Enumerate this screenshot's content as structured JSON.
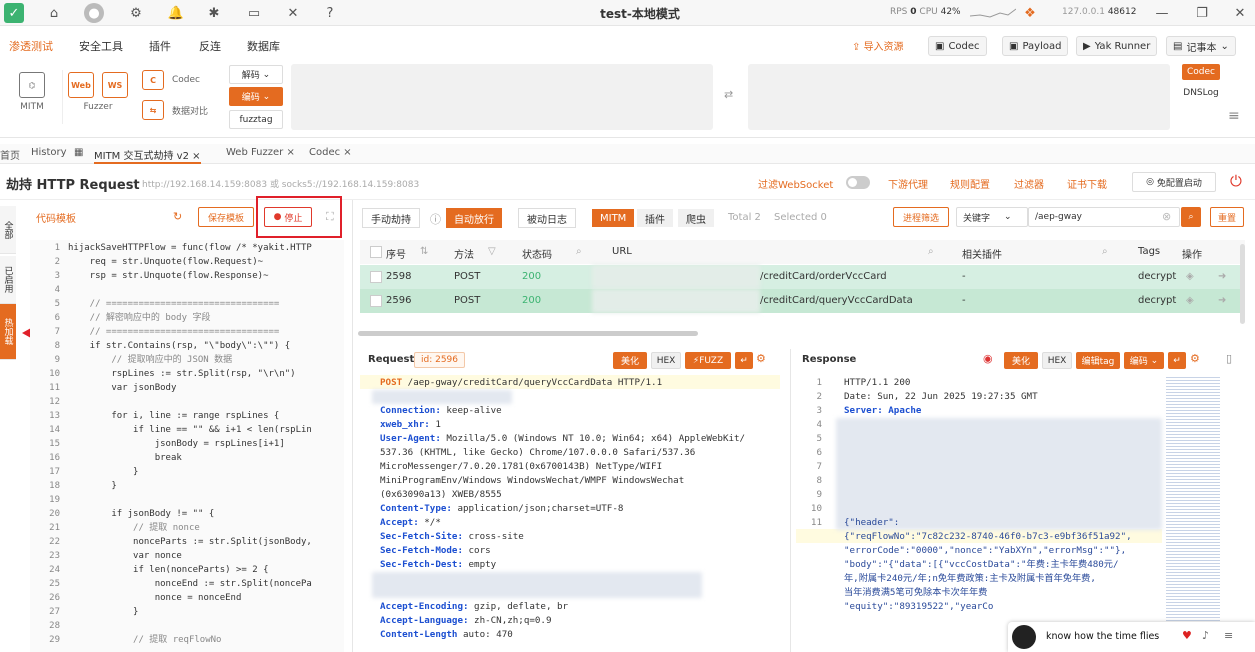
{
  "window": {
    "title": "test-本地模式",
    "rps_label": "RPS",
    "rps_value": "0",
    "cpu_label": "CPU",
    "cpu_value": "42%",
    "ip": "127.0.0.1",
    "port": "48612"
  },
  "menu": {
    "items": [
      "渗透测试",
      "安全工具",
      "插件",
      "反连",
      "数据库"
    ],
    "right": [
      "导入资源",
      "Codec",
      "Payload",
      "Yak Runner",
      "记事本"
    ]
  },
  "tools": {
    "mitm": "MITM",
    "fuzzer": "Fuzzer",
    "codec": "Codec",
    "compare": "数据对比",
    "decode": "解码",
    "encode": "编码",
    "fuzztag": "fuzztag",
    "codec_tag": "Codec",
    "dnslog": "DNSLog"
  },
  "tabs": [
    "首页",
    "History",
    "MITM 交互式劫持 v2",
    "Web Fuzzer",
    "Codec"
  ],
  "header": {
    "title": "劫持 HTTP Request",
    "proxy": "http://192.168.14.159:8083 或 socks5://192.168.14.159:8083",
    "filter_ws": "过滤WebSocket",
    "links": [
      "下游代理",
      "规则配置",
      "过滤器",
      "证书下载"
    ],
    "no_config": "免配置启动"
  },
  "side": [
    "全部",
    "已启用",
    "热加载"
  ],
  "left_panel": {
    "template": "代码模板",
    "save": "保存模板",
    "stop": "停止"
  },
  "code_lines": [
    {
      "n": "1",
      "t": "hijackSaveHTTPFlow = func(flow /* *yakit.HTTP"
    },
    {
      "n": "2",
      "t": "    req = str.Unquote(flow.Request)~"
    },
    {
      "n": "3",
      "t": "    rsp = str.Unquote(flow.Response)~"
    },
    {
      "n": "4",
      "t": ""
    },
    {
      "n": "5",
      "t": "    // ================================"
    },
    {
      "n": "6",
      "t": "    // 解密响应中的 body 字段"
    },
    {
      "n": "7",
      "t": "    // ================================"
    },
    {
      "n": "8",
      "t": "    if str.Contains(rsp, \"\\\"body\\\":\\\"\") {"
    },
    {
      "n": "9",
      "t": "        // 提取响应中的 JSON 数据"
    },
    {
      "n": "10",
      "t": "        rspLines := str.Split(rsp, \"\\r\\n\")"
    },
    {
      "n": "11",
      "t": "        var jsonBody"
    },
    {
      "n": "12",
      "t": ""
    },
    {
      "n": "13",
      "t": "        for i, line := range rspLines {"
    },
    {
      "n": "14",
      "t": "            if line == \"\" && i+1 < len(rspLin"
    },
    {
      "n": "15",
      "t": "                jsonBody = rspLines[i+1]"
    },
    {
      "n": "16",
      "t": "                break"
    },
    {
      "n": "17",
      "t": "            }"
    },
    {
      "n": "18",
      "t": "        }"
    },
    {
      "n": "19",
      "t": ""
    },
    {
      "n": "20",
      "t": "        if jsonBody != \"\" {"
    },
    {
      "n": "21",
      "t": "            // 提取 nonce"
    },
    {
      "n": "22",
      "t": "            nonceParts := str.Split(jsonBody,"
    },
    {
      "n": "23",
      "t": "            var nonce"
    },
    {
      "n": "24",
      "t": "            if len(nonceParts) >= 2 {"
    },
    {
      "n": "25",
      "t": "                nonceEnd := str.Split(noncePa"
    },
    {
      "n": "26",
      "t": "                nonce = nonceEnd"
    },
    {
      "n": "27",
      "t": "            }"
    },
    {
      "n": "28",
      "t": ""
    },
    {
      "n": "29",
      "t": "            // 提取 reqFlowNo"
    }
  ],
  "filter_tabs": {
    "manual": "手动劫持",
    "auto": "自动放行",
    "log": "被动日志",
    "mitm": "MITM",
    "plugin": "插件",
    "crawler": "爬虫",
    "total": "Total 2",
    "selected": "Selected 0",
    "process_filter": "进程筛选",
    "keyword": "关键字",
    "search_value": "/aep-gway",
    "reset": "重置"
  },
  "table": {
    "headers": [
      "序号",
      "方法",
      "状态码",
      "URL",
      "相关插件",
      "Tags",
      "操作"
    ],
    "rows": [
      {
        "id": "2598",
        "method": "POST",
        "status": "200",
        "url": "/creditCard/orderVccCard",
        "plugin": "-",
        "tags": "decrypt"
      },
      {
        "id": "2596",
        "method": "POST",
        "status": "200",
        "url": "/creditCard/queryVccCardData",
        "plugin": "-",
        "tags": "decrypt"
      }
    ]
  },
  "request": {
    "label": "Request",
    "id": "id: 2596",
    "beautify": "美化",
    "hex": "HEX",
    "fuzz": "FUZZ",
    "lines": [
      {
        "k": "POST",
        "v": " /aep-gway/creditCard/queryVccCardData HTTP/1.1"
      },
      {
        "k": "",
        "v": ""
      },
      {
        "k": "Connection:",
        "v": " keep-alive"
      },
      {
        "k": "xweb_xhr:",
        "v": " 1"
      },
      {
        "k": "User-Agent:",
        "v": " Mozilla/5.0 (Windows NT 10.0; Win64; x64) AppleWebKit/"
      },
      {
        "k": "",
        "v": "537.36 (KHTML, like Gecko) Chrome/107.0.0.0 Safari/537.36"
      },
      {
        "k": "",
        "v": "MicroMessenger/7.0.20.1781(0x6700143B) NetType/WIFI"
      },
      {
        "k": "",
        "v": "MiniProgramEnv/Windows WindowsWechat/WMPF WindowsWechat"
      },
      {
        "k": "",
        "v": "(0x63090a13) XWEB/8555"
      },
      {
        "k": "Content-Type:",
        "v": " application/json;charset=UTF-8"
      },
      {
        "k": "Accept:",
        "v": " */*"
      },
      {
        "k": "Sec-Fetch-Site:",
        "v": " cross-site"
      },
      {
        "k": "Sec-Fetch-Mode:",
        "v": " cors"
      },
      {
        "k": "Sec-Fetch-Dest:",
        "v": " empty"
      },
      {
        "k": "",
        "v": ""
      },
      {
        "k": "",
        "v": ""
      },
      {
        "k": "Accept-Encoding:",
        "v": " gzip, deflate, br"
      },
      {
        "k": "Accept-Language:",
        "v": " zh-CN,zh;q=0.9"
      },
      {
        "k": "Content-Length",
        "v": " auto: 470"
      }
    ]
  },
  "response": {
    "label": "Response",
    "beautify": "美化",
    "hex": "HEX",
    "edit_tag": "编辑tag",
    "encode": "编码",
    "lines": [
      {
        "n": "1",
        "t": "HTTP/1.1 200"
      },
      {
        "n": "2",
        "t": "Date: Sun, 22 Jun 2025 19:27:35 GMT"
      },
      {
        "n": "3",
        "t": "Server: Apache"
      },
      {
        "n": "4",
        "t": ""
      },
      {
        "n": "5",
        "t": ""
      },
      {
        "n": "6",
        "t": ""
      },
      {
        "n": "7",
        "t": ""
      },
      {
        "n": "8",
        "t": ""
      },
      {
        "n": "9",
        "t": ""
      },
      {
        "n": "10",
        "t": ""
      },
      {
        "n": "11",
        "t": "{\"header\":"
      },
      {
        "n": "",
        "t": "{\"reqFlowNo\":\"7c82c232-8740-46f0-b7c3-e9bf36f51a92\","
      },
      {
        "n": "",
        "t": "\"errorCode\":\"0000\",\"nonce\":\"YabXYn\",\"errorMsg\":\"\"},"
      },
      {
        "n": "",
        "t": "\"body\":\"{\"data\":[{\"vccCostData\":\"年费:主卡年费480元/"
      },
      {
        "n": "",
        "t": "年,附属卡240元/年;n免年费政策:主卡及附属卡首年免年费,"
      },
      {
        "n": "",
        "t": "当年消费满5笔可免除本卡次年年费"
      },
      {
        "n": "",
        "t": "\"equity\":\"89319522\",\"yearCo"
      }
    ]
  },
  "music": {
    "text": "know how the time flies"
  }
}
